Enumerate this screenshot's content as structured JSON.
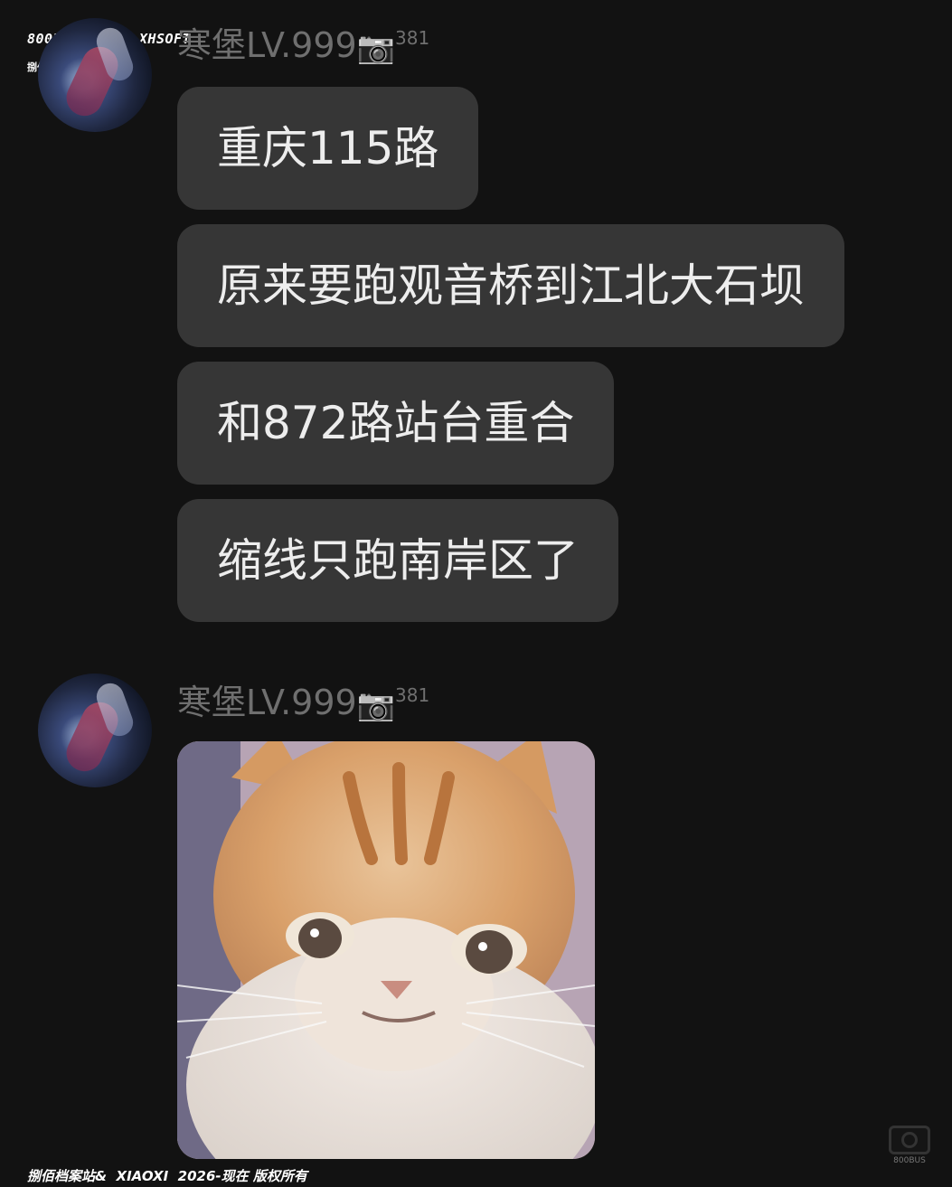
{
  "watermark": {
    "top_site": "800BUS.TOP | XHSOFT",
    "top_sub": "捌佰档案站",
    "bottom": "捌佰档案站&  XIAOXI  2026-现在 版权所有",
    "logo_text": "800BUS"
  },
  "messages": [
    {
      "sender": "寒堡LV.999",
      "camera_icon": "📷",
      "count": "381",
      "bubbles": [
        "重庆115路",
        "原来要跑观音桥到江北大石坝",
        "和872路站台重合",
        "缩线只跑南岸区了"
      ]
    },
    {
      "sender": "寒堡LV.999",
      "camera_icon": "📷",
      "count": "381",
      "image": "sad-cat-sticker"
    }
  ],
  "colors": {
    "background": "#121212",
    "bubble": "#363636",
    "bubble_text": "#ededed",
    "name_text": "#6f6f6f"
  }
}
